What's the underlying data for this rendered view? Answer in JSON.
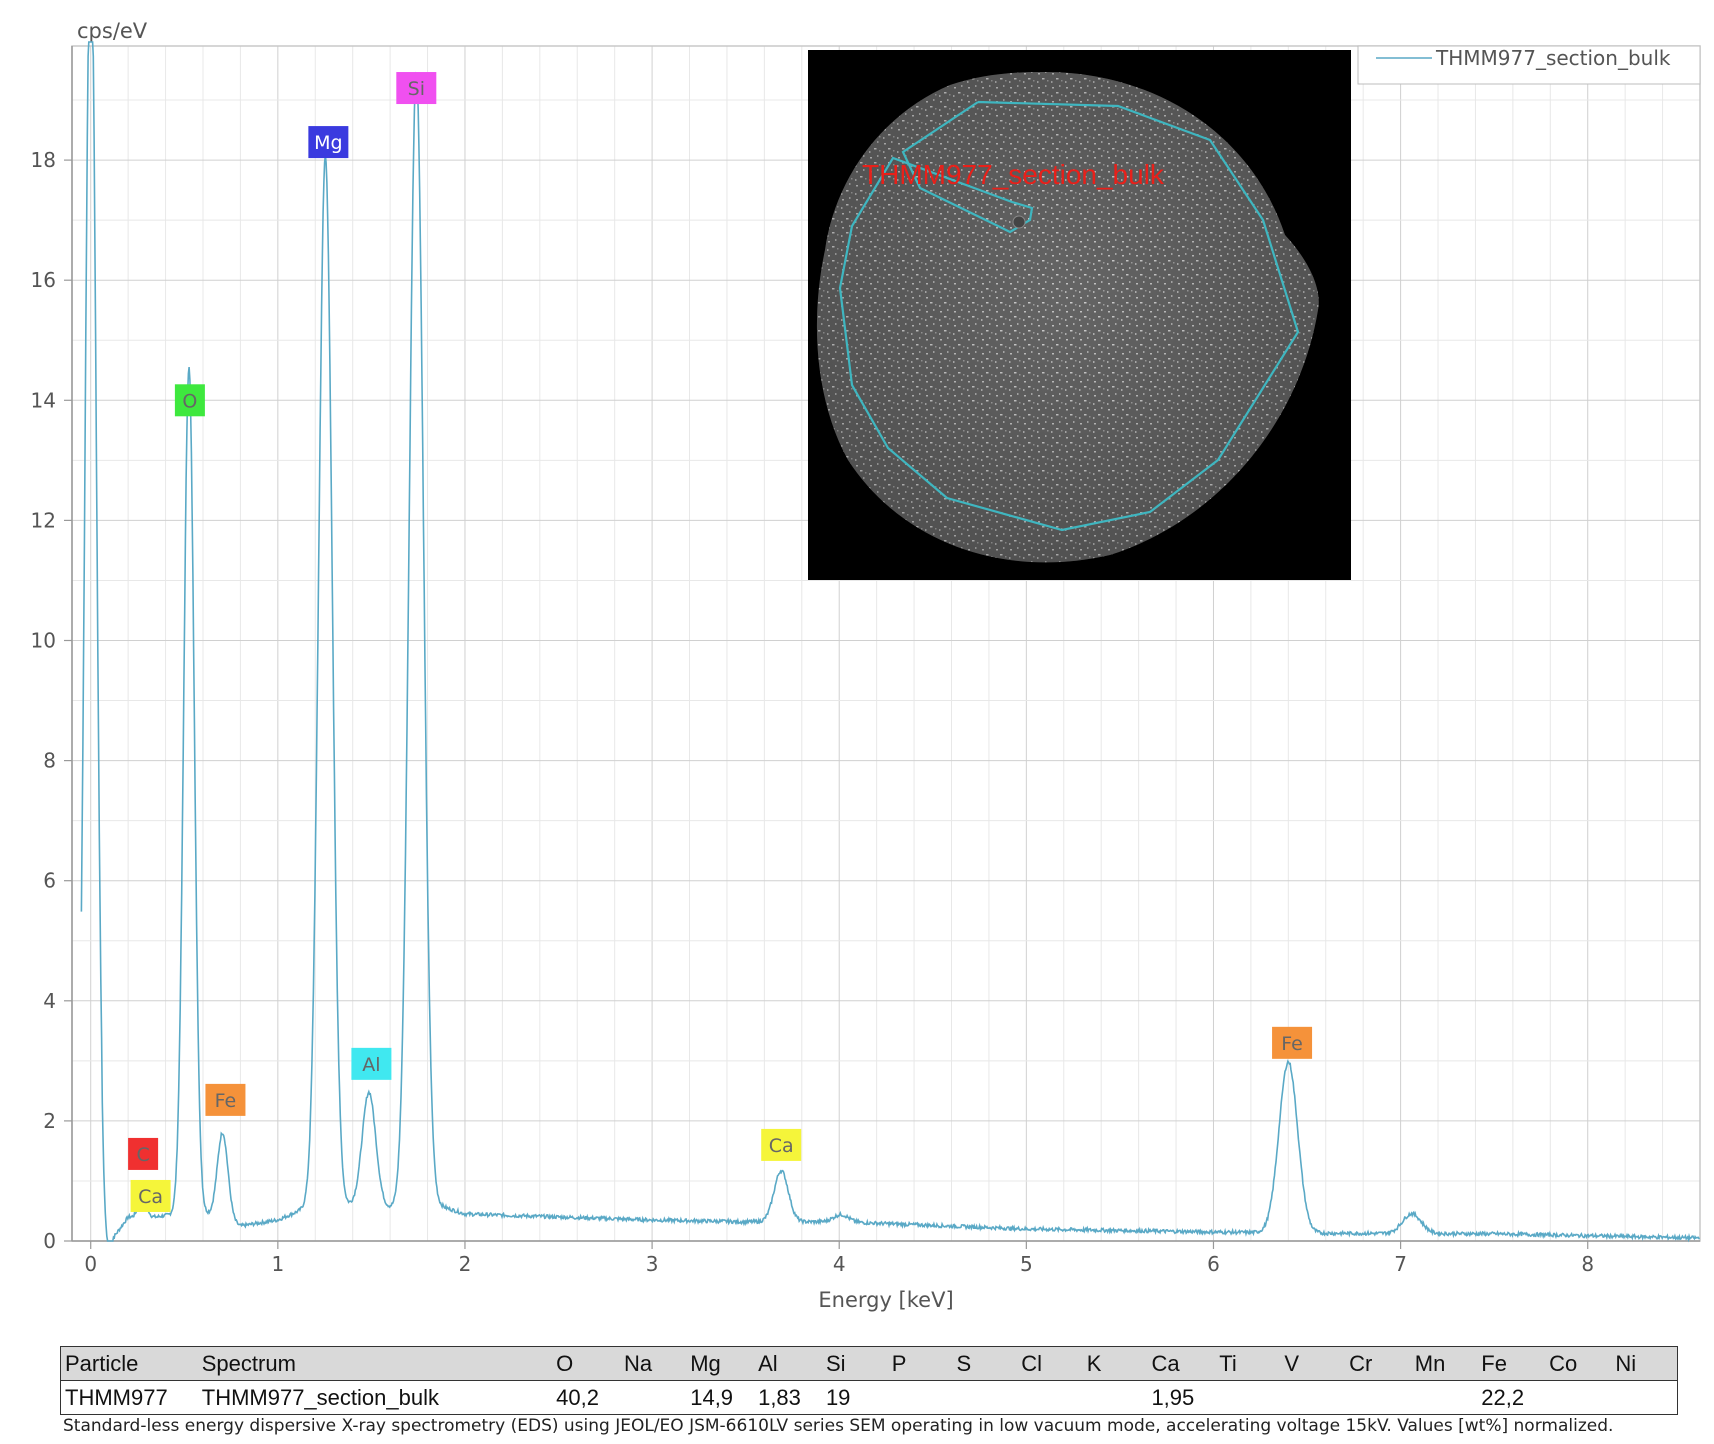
{
  "chart_data": {
    "type": "line",
    "ylabel": "cps/eV",
    "xlabel": "Energy [keV]",
    "xlim": [
      -0.1,
      8.6
    ],
    "ylim": [
      0,
      19.9
    ],
    "x_ticks": [
      0,
      1,
      2,
      3,
      4,
      5,
      6,
      7,
      8
    ],
    "y_ticks": [
      0,
      2,
      4,
      6,
      8,
      10,
      12,
      14,
      16,
      18
    ],
    "grid": true,
    "legend_position": "top-right",
    "line_color": "#5aa9c6",
    "series": [
      {
        "name": "THMM977_section_bulk",
        "baseline": [
          [
            0.12,
            0.05
          ],
          [
            0.2,
            0.4
          ],
          [
            0.35,
            0.4
          ],
          [
            0.45,
            0.45
          ],
          [
            0.62,
            0.45
          ],
          [
            0.8,
            0.25
          ],
          [
            1.0,
            0.35
          ],
          [
            1.15,
            0.55
          ],
          [
            1.4,
            0.6
          ],
          [
            1.62,
            0.55
          ],
          [
            1.85,
            0.6
          ],
          [
            2.0,
            0.45
          ],
          [
            3.0,
            0.35
          ],
          [
            3.5,
            0.32
          ],
          [
            4.0,
            0.32
          ],
          [
            5.0,
            0.2
          ],
          [
            6.0,
            0.15
          ],
          [
            6.5,
            0.13
          ],
          [
            7.5,
            0.12
          ],
          [
            8.6,
            0.05
          ]
        ],
        "peaks": [
          {
            "x": 0.0,
            "height": 22.0,
            "width": 0.03
          },
          {
            "x": 0.277,
            "height": 0.4,
            "width": 0.02
          },
          {
            "x": 0.525,
            "height": 14.1,
            "width": 0.028
          },
          {
            "x": 0.705,
            "height": 1.45,
            "width": 0.028
          },
          {
            "x": 1.254,
            "height": 17.5,
            "width": 0.036
          },
          {
            "x": 1.487,
            "height": 1.9,
            "width": 0.036
          },
          {
            "x": 1.74,
            "height": 18.9,
            "width": 0.038
          },
          {
            "x": 3.69,
            "height": 0.85,
            "width": 0.038
          },
          {
            "x": 4.01,
            "height": 0.12,
            "width": 0.04
          },
          {
            "x": 6.4,
            "height": 2.85,
            "width": 0.05
          },
          {
            "x": 7.06,
            "height": 0.33,
            "width": 0.05
          }
        ]
      }
    ],
    "annotations": [
      {
        "label": "Si",
        "x": 1.74,
        "y": 19.2,
        "color": "#f050f0"
      },
      {
        "label": "Mg",
        "x": 1.27,
        "y": 18.3,
        "color": "#3a3adf"
      },
      {
        "label": "O",
        "x": 0.53,
        "y": 14.0,
        "color": "#3ee83e"
      },
      {
        "label": "Al",
        "x": 1.5,
        "y": 2.95,
        "color": "#40e8f0"
      },
      {
        "label": "Fe",
        "x": 0.72,
        "y": 2.35,
        "color": "#f5923a"
      },
      {
        "label": "C",
        "x": 0.28,
        "y": 1.45,
        "color": "#f03030"
      },
      {
        "label": "Ca",
        "x": 0.32,
        "y": 0.75,
        "color": "#f5f53a"
      },
      {
        "label": "Ca",
        "x": 3.69,
        "y": 1.6,
        "color": "#f5f53a"
      },
      {
        "label": "Fe",
        "x": 6.42,
        "y": 3.3,
        "color": "#f5923a"
      }
    ]
  },
  "inset": {
    "label": "THMM977_section_bulk"
  },
  "table": {
    "headers": [
      "Particle",
      "Spectrum",
      "O",
      "Na",
      "Mg",
      "Al",
      "Si",
      "P",
      "S",
      "Cl",
      "K",
      "Ca",
      "Ti",
      "V",
      "Cr",
      "Mn",
      "Fe",
      "Co",
      "Ni"
    ],
    "rows": [
      [
        "THMM977",
        "THMM977_section_bulk",
        "40,2",
        "",
        "14,9",
        "1,83",
        "19",
        "",
        "",
        "",
        "",
        "1,95",
        "",
        "",
        "",
        "",
        "22,2",
        "",
        ""
      ]
    ]
  },
  "footnote": "Standard-less energy dispersive X-ray spectrometry (EDS) using JEOL/EO JSM-6610LV series SEM operating in low vacuum mode, accelerating voltage 15kV. Values [wt%] normalized."
}
